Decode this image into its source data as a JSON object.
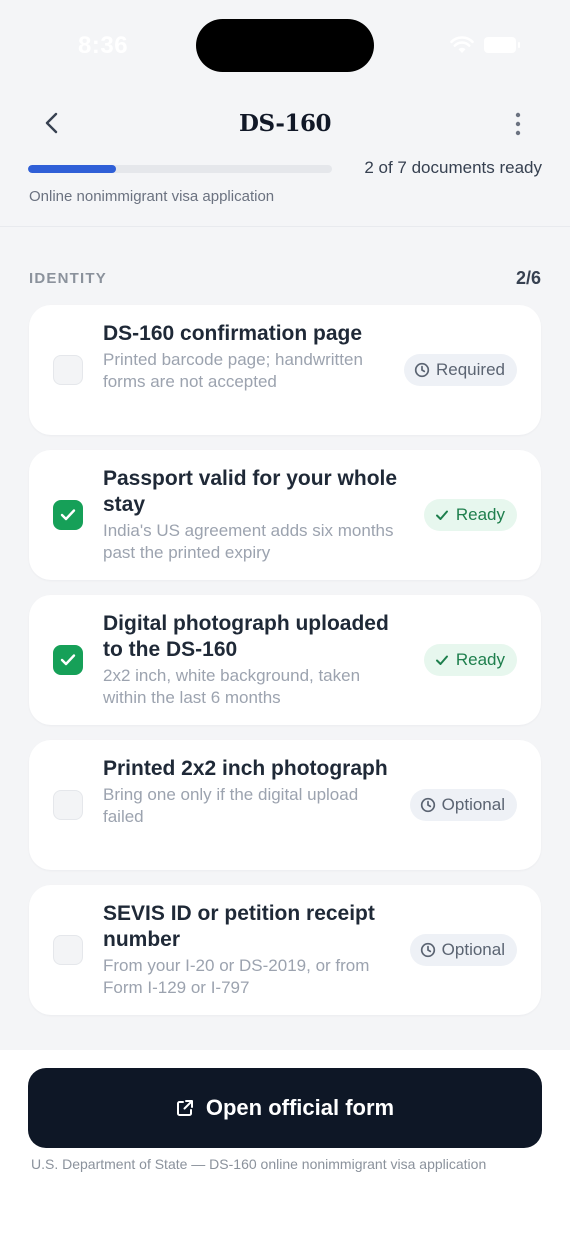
{
  "status_bar": {
    "time": "8:36"
  },
  "header": {
    "title": "DS-160"
  },
  "progress": {
    "fraction": 0.29,
    "text": "2 of 7 documents ready"
  },
  "subtitle": "Online nonimmigrant visa application",
  "section": {
    "title": "IDENTITY",
    "count": "2/6"
  },
  "items": [
    {
      "title": "DS-160 confirmation page",
      "subtitle": "Printed barcode page; handwritten forms are not accepted",
      "checked": false,
      "badge": "Required",
      "badge_icon": "clock-icon"
    },
    {
      "title": "Passport valid for your whole stay",
      "subtitle": "India's US agreement adds six months past the printed expiry",
      "checked": true,
      "badge": "Ready",
      "badge_icon": "check-icon"
    },
    {
      "title": "Digital photograph uploaded to the DS-160",
      "subtitle": "2x2 inch, white background, taken within the last 6 months",
      "checked": true,
      "badge": "Ready",
      "badge_icon": "check-icon"
    },
    {
      "title": "Printed 2x2 inch photograph",
      "subtitle": "Bring one only if the digital upload failed",
      "checked": false,
      "badge": "Optional",
      "badge_icon": "clock-icon"
    },
    {
      "title": "SEVIS ID or petition receipt number",
      "subtitle": "From your I-20 or DS-2019, or from Form I-129 or I-797",
      "checked": false,
      "badge": "Optional",
      "badge_icon": "clock-icon"
    }
  ],
  "cta": {
    "label": "Open official form",
    "icon": "external-link-icon"
  },
  "source": "U.S. Department of State — DS-160 online nonimmigrant visa application",
  "colors": {
    "accent": "#2f5fd7",
    "ready": "#16a058",
    "cta_bg": "#0e1726"
  }
}
